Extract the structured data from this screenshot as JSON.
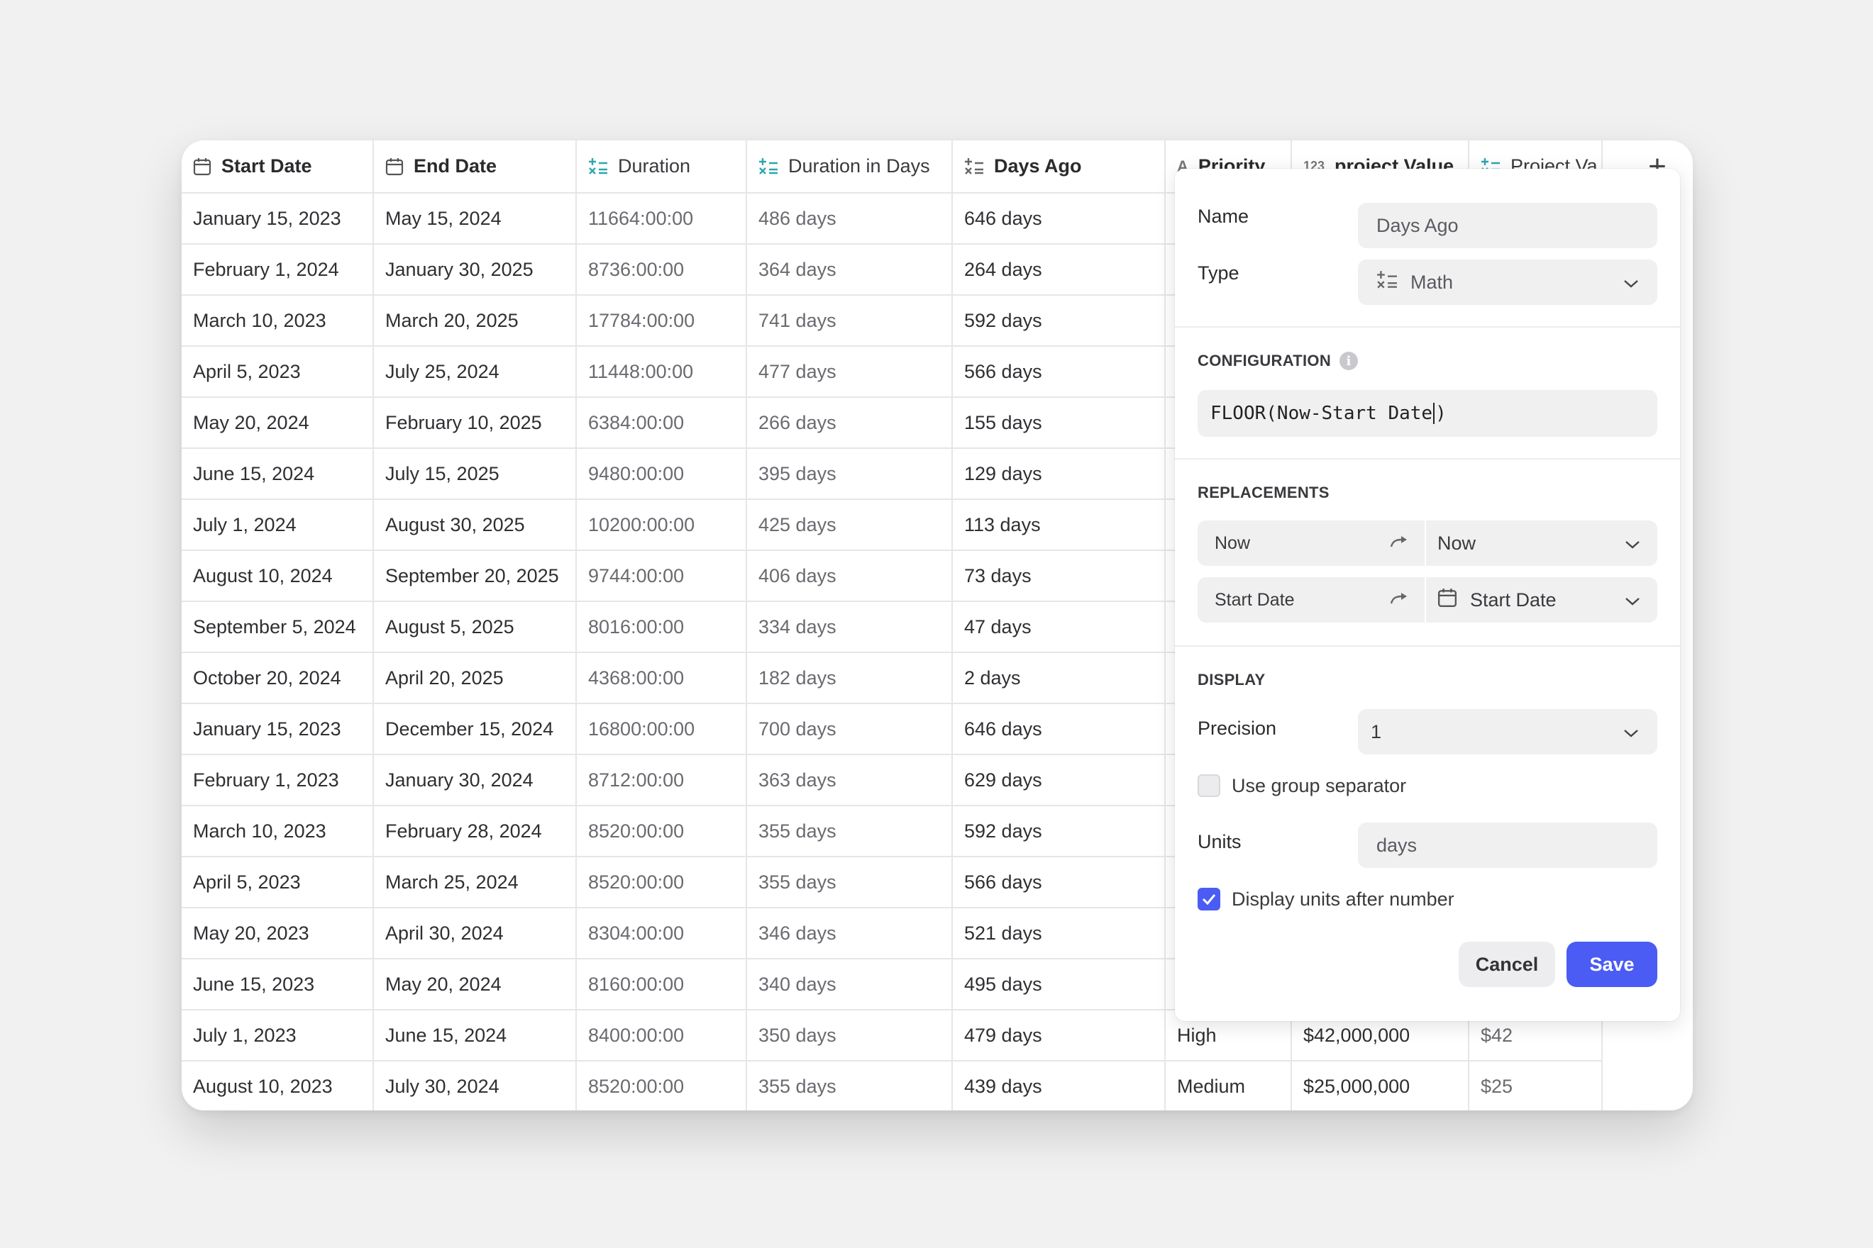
{
  "table": {
    "columns": [
      {
        "label": "Start Date",
        "icon": "calendar-icon"
      },
      {
        "label": "End Date",
        "icon": "calendar-icon"
      },
      {
        "label": "Duration",
        "icon": "math-icon"
      },
      {
        "label": "Duration in Days",
        "icon": "math-icon"
      },
      {
        "label": "Days Ago",
        "icon": "math-icon"
      },
      {
        "label": "Priority",
        "icon": "text-icon"
      },
      {
        "label": "project Value",
        "icon": "number-icon"
      },
      {
        "label": "Project Va",
        "icon": "math-icon"
      }
    ],
    "rows": [
      [
        "January 15, 2023",
        "May 15, 2024",
        "11664:00:00",
        "486 days",
        "646 days",
        "",
        "",
        ""
      ],
      [
        "February 1, 2024",
        "January 30, 2025",
        "8736:00:00",
        "364 days",
        "264 days",
        "",
        "",
        ""
      ],
      [
        "March 10, 2023",
        "March 20, 2025",
        "17784:00:00",
        "741 days",
        "592 days",
        "",
        "",
        ""
      ],
      [
        "April 5, 2023",
        "July 25, 2024",
        "11448:00:00",
        "477 days",
        "566 days",
        "",
        "",
        ""
      ],
      [
        "May 20, 2024",
        "February 10, 2025",
        "6384:00:00",
        "266 days",
        "155 days",
        "",
        "",
        ""
      ],
      [
        "June 15, 2024",
        "July 15, 2025",
        "9480:00:00",
        "395 days",
        "129 days",
        "",
        "",
        ""
      ],
      [
        "July 1, 2024",
        "August 30, 2025",
        "10200:00:00",
        "425 days",
        "113 days",
        "",
        "",
        ""
      ],
      [
        "August 10, 2024",
        "September 20, 2025",
        "9744:00:00",
        "406 days",
        "73 days",
        "",
        "",
        ""
      ],
      [
        "September 5, 2024",
        "August 5, 2025",
        "8016:00:00",
        "334 days",
        "47 days",
        "",
        "",
        ""
      ],
      [
        "October 20, 2024",
        "April 20, 2025",
        "4368:00:00",
        "182 days",
        "2 days",
        "",
        "",
        ""
      ],
      [
        "January 15, 2023",
        "December 15, 2024",
        "16800:00:00",
        "700 days",
        "646 days",
        "",
        "",
        ""
      ],
      [
        "February 1, 2023",
        "January 30, 2024",
        "8712:00:00",
        "363 days",
        "629 days",
        "",
        "",
        ""
      ],
      [
        "March 10, 2023",
        "February 28, 2024",
        "8520:00:00",
        "355 days",
        "592 days",
        "",
        "",
        ""
      ],
      [
        "April 5, 2023",
        "March 25, 2024",
        "8520:00:00",
        "355 days",
        "566 days",
        "",
        "",
        ""
      ],
      [
        "May 20, 2023",
        "April 30, 2024",
        "8304:00:00",
        "346 days",
        "521 days",
        "",
        "",
        ""
      ],
      [
        "June 15, 2023",
        "May 20, 2024",
        "8160:00:00",
        "340 days",
        "495 days",
        "",
        "",
        ""
      ],
      [
        "July 1, 2023",
        "June 15, 2024",
        "8400:00:00",
        "350 days",
        "479 days",
        "High",
        "$42,000,000",
        "$42"
      ],
      [
        "August 10, 2023",
        "July 30, 2024",
        "8520:00:00",
        "355 days",
        "439 days",
        "Medium",
        "$25,000,000",
        "$25"
      ]
    ]
  },
  "panel": {
    "name_label": "Name",
    "name_value": "Days Ago",
    "type_label": "Type",
    "type_value": "Math",
    "configuration_title": "CONFIGURATION",
    "formula_before_caret": "FLOOR(Now-Start Date",
    "formula_after_caret": ")",
    "replacements_title": "REPLACEMENTS",
    "replacements": [
      {
        "from": "Now",
        "to": "Now",
        "to_icon": ""
      },
      {
        "from": "Start Date",
        "to": "Start Date",
        "to_icon": "calendar-icon"
      }
    ],
    "display_title": "DISPLAY",
    "precision_label": "Precision",
    "precision_value": "1",
    "group_separator_label": "Use group separator",
    "group_separator_checked": false,
    "units_label": "Units",
    "units_value": "days",
    "units_after_label": "Display units after number",
    "units_after_checked": true,
    "cancel_label": "Cancel",
    "save_label": "Save"
  },
  "colors": {
    "accent": "#4a5cf4",
    "math_icon": "#2ba6b0",
    "background": "#f1f1f2"
  }
}
